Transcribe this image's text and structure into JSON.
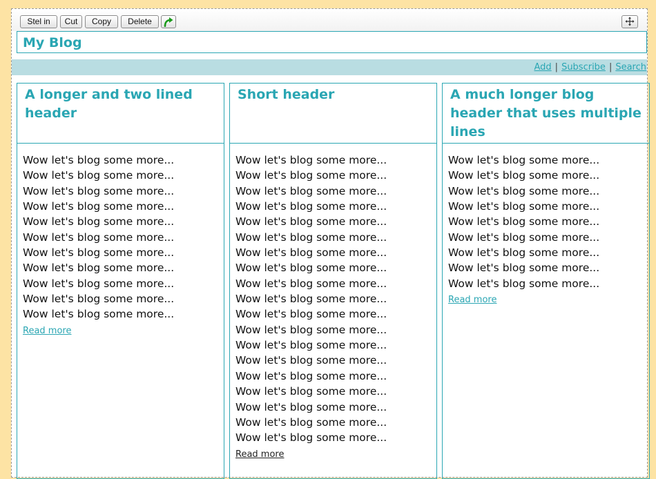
{
  "toolbar": {
    "buttons": [
      "Stel in",
      "Cut",
      "Copy",
      "Delete"
    ],
    "redo_icon": "green-curved-arrow-icon",
    "move_icon": "move-arrows-icon"
  },
  "blog": {
    "title": "My Blog"
  },
  "nav": {
    "links": [
      "Add",
      "Subscribe",
      "Search"
    ],
    "separator": "|"
  },
  "colors": {
    "accent": "#2aa6b3",
    "nav_bar": "#b9dde2",
    "page_background": "#fde3a4"
  },
  "posts": [
    {
      "title": "A longer and two lined header",
      "lines": [
        "Wow let's blog some more...",
        "Wow let's blog some more...",
        "Wow let's blog some more...",
        "Wow let's blog some more...",
        "Wow let's blog some more...",
        "Wow let's blog some more...",
        "Wow let's blog some more...",
        "Wow let's blog some more...",
        "Wow let's blog some more...",
        "Wow let's blog some more...",
        "Wow let's blog some more..."
      ],
      "read_more": "Read more"
    },
    {
      "title": "Short header",
      "lines": [
        "Wow let's blog some more...",
        "Wow let's blog some more...",
        "Wow let's blog some more...",
        "Wow let's blog some more...",
        "Wow let's blog some more...",
        "Wow let's blog some more...",
        "Wow let's blog some more...",
        "Wow let's blog some more...",
        "Wow let's blog some more...",
        "Wow let's blog some more...",
        "Wow let's blog some more...",
        "Wow let's blog some more...",
        "Wow let's blog some more...",
        "Wow let's blog some more...",
        "Wow let's blog some more...",
        "Wow let's blog some more...",
        "Wow let's blog some more...",
        "Wow let's blog some more...",
        "Wow let's blog some more..."
      ],
      "read_more": "Read more"
    },
    {
      "title": "A much longer blog header that uses multiple lines",
      "lines": [
        "Wow let's blog some more...",
        "Wow let's blog some more...",
        "Wow let's blog some more...",
        "Wow let's blog some more...",
        "Wow let's blog some more...",
        "Wow let's blog some more...",
        "Wow let's blog some more...",
        "Wow let's blog some more...",
        "Wow let's blog some more..."
      ],
      "read_more": "Read more"
    }
  ]
}
